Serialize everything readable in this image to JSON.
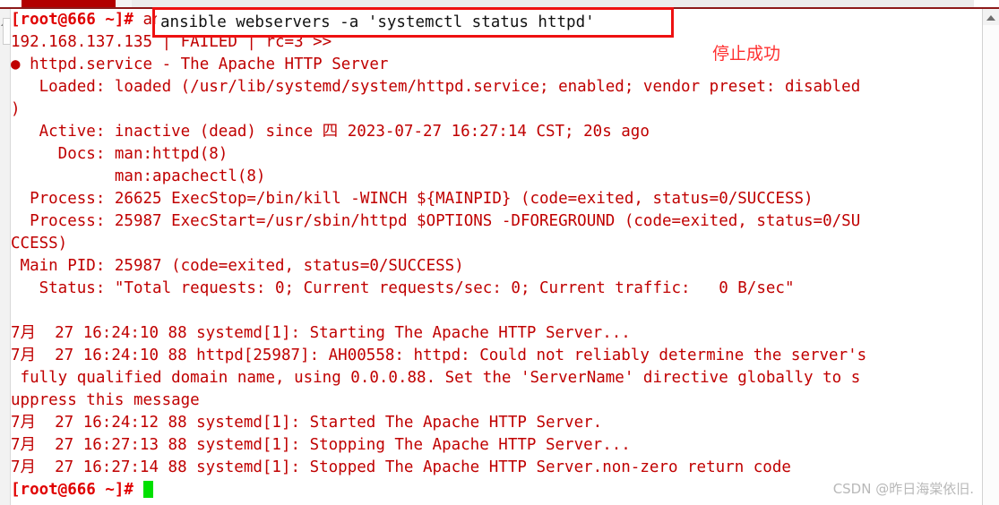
{
  "window": {
    "title_strip_color": "#b20000",
    "background": "#ffffff",
    "text_color": "#c00000"
  },
  "annotation": {
    "command_box_label": "ansible webservers -a 'systemctl status httpd'",
    "note_text": "停止成功",
    "note_color": "#ff3030",
    "box_border_color": "#ee1111"
  },
  "watermark": {
    "text": "CSDN @昨日海棠依旧."
  },
  "terminal": {
    "lines": [
      "[root@666 ~]# ansible webservers -a 'systemctl status httpd'",
      "192.168.137.135 | FAILED | rc=3 >>",
      "● httpd.service - The Apache HTTP Server",
      "   Loaded: loaded (/usr/lib/systemd/system/httpd.service; enabled; vendor preset: disabled",
      ")",
      "   Active: inactive (dead) since 四 2023-07-27 16:27:14 CST; 20s ago",
      "     Docs: man:httpd(8)",
      "           man:apachectl(8)",
      "  Process: 26625 ExecStop=/bin/kill -WINCH ${MAINPID} (code=exited, status=0/SUCCESS)",
      "  Process: 25987 ExecStart=/usr/sbin/httpd $OPTIONS -DFOREGROUND (code=exited, status=0/SU",
      "CCESS)",
      " Main PID: 25987 (code=exited, status=0/SUCCESS)",
      "   Status: \"Total requests: 0; Current requests/sec: 0; Current traffic:   0 B/sec\"",
      "",
      "7月  27 16:24:10 88 systemd[1]: Starting The Apache HTTP Server...",
      "7月  27 16:24:10 88 httpd[25987]: AH00558: httpd: Could not reliably determine the server's",
      " fully qualified domain name, using 0.0.0.88. Set the 'ServerName' directive globally to s",
      "uppress this message",
      "7月  27 16:24:12 88 systemd[1]: Started The Apache HTTP Server.",
      "7月  27 16:27:13 88 systemd[1]: Stopping The Apache HTTP Server...",
      "7月  27 16:27:14 88 systemd[1]: Stopped The Apache HTTP Server.non-zero return code",
      "[root@666 ~]# "
    ],
    "prompt_line_first": "[root@666 ~]#",
    "prompt_line_last": "[root@666 ~]#",
    "host": "666",
    "user": "root",
    "cwd": "~",
    "target_ip": "192.168.137.135",
    "result_status": "FAILED",
    "return_code": "rc=3",
    "service": "httpd.service",
    "service_description": "The Apache HTTP Server",
    "loaded_state": "loaded",
    "unit_path": "/usr/lib/systemd/system/httpd.service",
    "enabled_state": "enabled",
    "vendor_preset": "disabled",
    "active_state": "inactive (dead)",
    "since": "四 2023-07-27 16:27:14 CST; 20s ago",
    "main_pid": "25987",
    "exec_stop_pid": "26625",
    "exec_start_pid": "25987",
    "total_requests": "0",
    "current_requests_per_sec": "0",
    "current_traffic": "0 B/sec"
  },
  "scrollbar": {
    "up_arrow": "scroll-up-arrow"
  }
}
